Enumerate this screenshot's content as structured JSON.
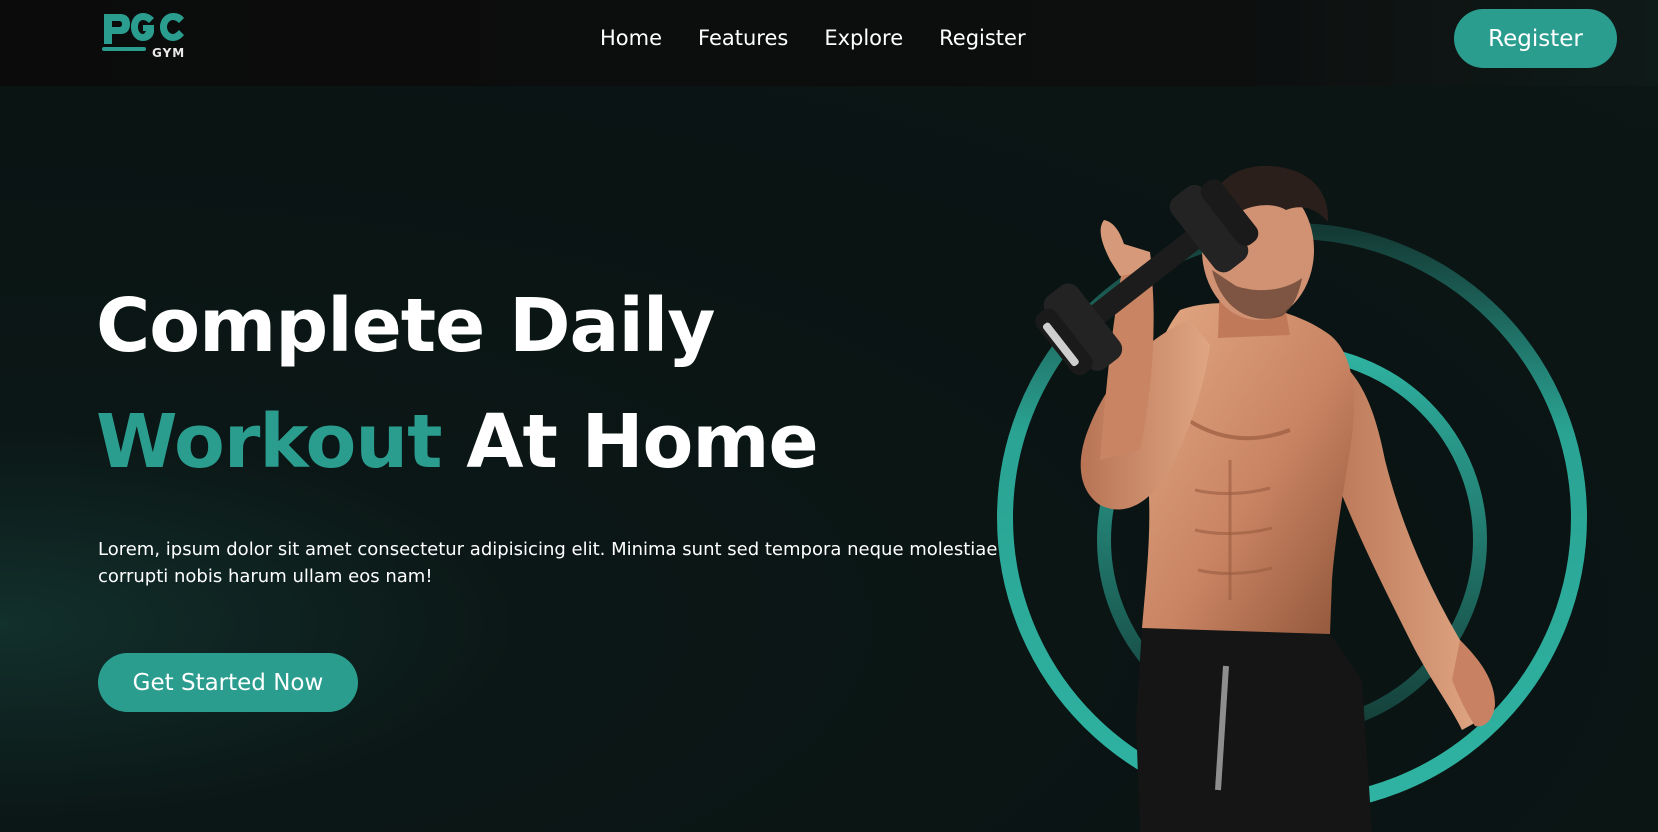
{
  "brand": {
    "logo_text": "PGC",
    "logo_sub": "GYM",
    "accent_color": "#2a9d8f"
  },
  "nav": {
    "links": [
      "Home",
      "Features",
      "Explore",
      "Register"
    ],
    "register_label": "Register"
  },
  "hero": {
    "title_line1": "Complete Daily",
    "title_accent": "Workout",
    "title_rest": " At Home",
    "description": "Lorem, ipsum dolor sit amet consectetur adipisicing elit. Minima sunt sed tempora neque molestiae corrupti nobis harum ullam eos nam!",
    "cta_label": "Get Started Now"
  }
}
